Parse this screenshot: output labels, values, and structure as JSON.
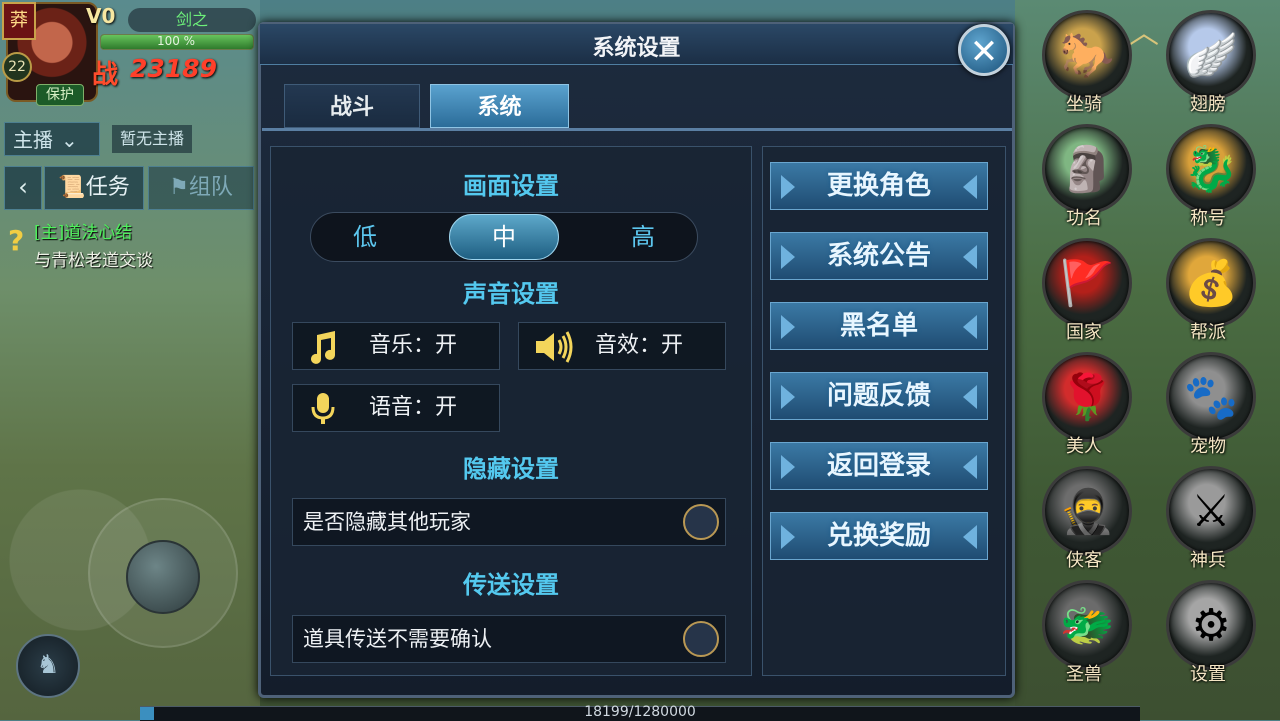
{
  "hud": {
    "stance": "莽",
    "vip": "V0",
    "player_name": "剑之",
    "level": "22",
    "hp_text": "100 %",
    "hp_fraction": 1.0,
    "power_icon": "战",
    "power_value": "23189",
    "protect": "保护"
  },
  "left_panel": {
    "broadcast_label": "主播",
    "broadcast_status": "暂无主播",
    "task_tab": "任务",
    "team_tab": "组队",
    "quest_title": "[主]道法心结",
    "quest_desc": "与青松老道交谈"
  },
  "dialog": {
    "title": "系统设置",
    "tabs": [
      {
        "label": "战斗",
        "active": false
      },
      {
        "label": "系统",
        "active": true
      }
    ],
    "graphics": {
      "title": "画面设置",
      "options": [
        "低",
        "中",
        "高"
      ],
      "selected": "中"
    },
    "sound": {
      "title": "声音设置",
      "music": "音乐：开",
      "effects": "音效：开",
      "voice": "语音：开"
    },
    "hide": {
      "title": "隐藏设置",
      "option": "是否隐藏其他玩家"
    },
    "teleport": {
      "title": "传送设置",
      "option": "道具传送不需要确认"
    },
    "side_buttons": [
      "更换角色",
      "系统公告",
      "黑名单",
      "问题反馈",
      "返回登录",
      "兑换奖励"
    ]
  },
  "right_menu": [
    {
      "label": "坐骑",
      "icon": "horse-icon",
      "glyph": "🐎",
      "color": "#caa24c"
    },
    {
      "label": "翅膀",
      "icon": "wing-icon",
      "glyph": "🪽",
      "color": "#b6c9ea"
    },
    {
      "label": "功名",
      "icon": "seal-icon",
      "glyph": "🗿",
      "color": "#7fb682"
    },
    {
      "label": "称号",
      "icon": "title-icon",
      "glyph": "🐉",
      "color": "#d8a03a"
    },
    {
      "label": "国家",
      "icon": "banner-icon",
      "glyph": "🚩",
      "color": "#b3201a"
    },
    {
      "label": "帮派",
      "icon": "guild-icon",
      "glyph": "💰",
      "color": "#e0a73b"
    },
    {
      "label": "美人",
      "icon": "rose-icon",
      "glyph": "🌹",
      "color": "#d22c2c"
    },
    {
      "label": "宠物",
      "icon": "paw-icon",
      "glyph": "🐾",
      "color": "#8f8f8f"
    },
    {
      "label": "侠客",
      "icon": "hero-icon",
      "glyph": "🥷",
      "color": "#6d6d6d"
    },
    {
      "label": "神兵",
      "icon": "weapon-icon",
      "glyph": "⚔",
      "color": "#9a9a9a"
    },
    {
      "label": "圣兽",
      "icon": "beast-icon",
      "glyph": "🐲",
      "color": "#6b6b6b"
    },
    {
      "label": "设置",
      "icon": "gear-icon",
      "glyph": "⚙",
      "color": "#a5a5a5"
    }
  ],
  "exp": {
    "text": "18199/1280000",
    "fraction": 0.0142
  }
}
